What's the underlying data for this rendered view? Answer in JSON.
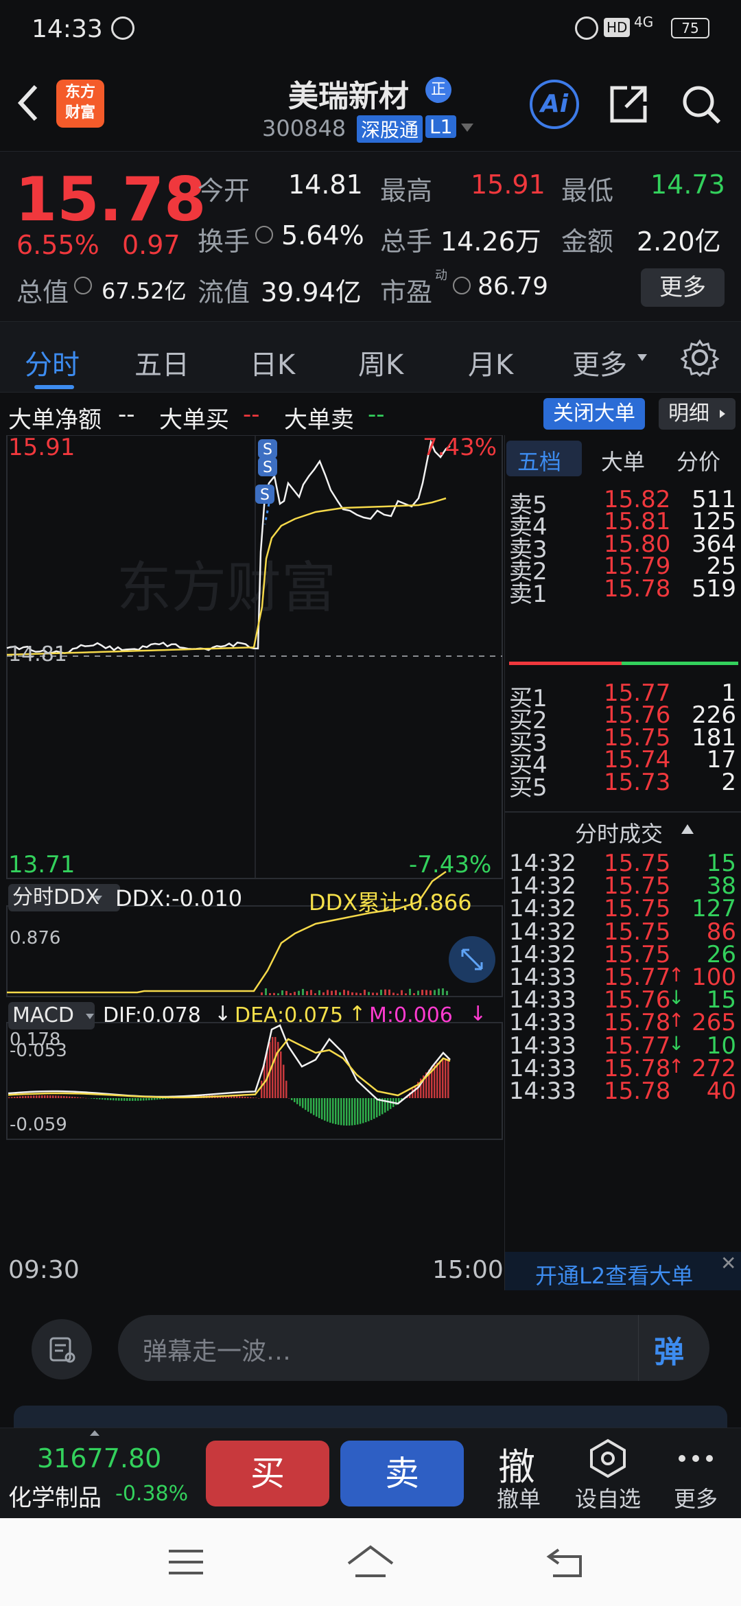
{
  "status_bar": {
    "time": "14:33",
    "battery": "75",
    "network": "4G"
  },
  "header": {
    "title": "美瑞新材",
    "badge": "正",
    "code": "300848",
    "market_tag": "深股通",
    "level_tag": "L1",
    "logo_line1": "东方",
    "logo_line2": "财富"
  },
  "quote": {
    "price": "15.78",
    "change_pct": "6.55%",
    "change_amt": "0.97",
    "open_label": "今开",
    "open": "14.81",
    "high_label": "最高",
    "high": "15.91",
    "low_label": "最低",
    "low": "14.73",
    "turnover_label": "换手",
    "turnover": "5.64%",
    "volume_label": "总手",
    "volume": "14.26万",
    "amount_label": "金额",
    "amount": "2.20亿",
    "mktcap_label": "总值",
    "mktcap": "67.52亿",
    "float_label": "流值",
    "float_cap": "39.94亿",
    "pe_label": "市盈",
    "pe_sup": "动",
    "pe": "86.79",
    "more_button": "更多"
  },
  "tabs": [
    "分时",
    "五日",
    "日K",
    "周K",
    "月K",
    "更多"
  ],
  "legend": {
    "net_label": "大单净额",
    "net_val": "--",
    "buy_label": "大单买",
    "buy_val": "--",
    "sell_label": "大单卖",
    "sell_val": "--",
    "close_big_button": "关闭大单",
    "detail_button": "明细"
  },
  "chart": {
    "top_price": "15.91",
    "top_pct": "7.43%",
    "mid_price": "14.81",
    "bottom_price": "13.71",
    "bottom_pct": "-7.43%",
    "watermark": "东方财富",
    "signal_marker": "S",
    "time_start": "09:30",
    "time_end": "15:00"
  },
  "ddx": {
    "selector": "分时DDX",
    "ddx_label": "DDX:-0.010",
    "cum_label": "DDX累计:0.866",
    "top": "0.876",
    "bottom": "-0.053"
  },
  "macd": {
    "selector": "MACD",
    "dif": "DIF:0.078",
    "dea": "DEA:0.075",
    "m": "M:0.006",
    "top": "0.178",
    "bottom": "-0.059"
  },
  "order_book": {
    "tabs": [
      "五档",
      "大单",
      "分价"
    ],
    "asks": [
      {
        "label": "卖5",
        "price": "15.82",
        "vol": "511"
      },
      {
        "label": "卖4",
        "price": "15.81",
        "vol": "125"
      },
      {
        "label": "卖3",
        "price": "15.80",
        "vol": "364"
      },
      {
        "label": "卖2",
        "price": "15.79",
        "vol": "25"
      },
      {
        "label": "卖1",
        "price": "15.78",
        "vol": "519"
      }
    ],
    "bids": [
      {
        "label": "买1",
        "price": "15.77",
        "vol": "1"
      },
      {
        "label": "买2",
        "price": "15.76",
        "vol": "226"
      },
      {
        "label": "买3",
        "price": "15.75",
        "vol": "181"
      },
      {
        "label": "买4",
        "price": "15.74",
        "vol": "17"
      },
      {
        "label": "买5",
        "price": "15.73",
        "vol": "2"
      }
    ],
    "trades_title": "分时成交",
    "trades": [
      {
        "time": "14:32",
        "price": "15.75",
        "arrow": "",
        "vol": "15",
        "dir": "sell"
      },
      {
        "time": "14:32",
        "price": "15.75",
        "arrow": "",
        "vol": "38",
        "dir": "sell"
      },
      {
        "time": "14:32",
        "price": "15.75",
        "arrow": "",
        "vol": "127",
        "dir": "sell"
      },
      {
        "time": "14:32",
        "price": "15.75",
        "arrow": "",
        "vol": "86",
        "dir": "buy"
      },
      {
        "time": "14:32",
        "price": "15.75",
        "arrow": "",
        "vol": "26",
        "dir": "sell"
      },
      {
        "time": "14:33",
        "price": "15.77",
        "arrow": "↑",
        "vol": "100",
        "dir": "buy"
      },
      {
        "time": "14:33",
        "price": "15.76",
        "arrow": "↓",
        "vol": "15",
        "dir": "sell"
      },
      {
        "time": "14:33",
        "price": "15.78",
        "arrow": "↑",
        "vol": "265",
        "dir": "buy"
      },
      {
        "time": "14:33",
        "price": "15.77",
        "arrow": "↓",
        "vol": "10",
        "dir": "sell"
      },
      {
        "time": "14:33",
        "price": "15.78",
        "arrow": "↑",
        "vol": "272",
        "dir": "buy"
      },
      {
        "time": "14:33",
        "price": "15.78",
        "arrow": "",
        "vol": "40",
        "dir": "buy"
      }
    ],
    "l2_promo": "开通L2查看大单"
  },
  "bullet": {
    "placeholder": "弹幕走一波…",
    "send_icon": "弹"
  },
  "bottom_bar": {
    "index_value": "31677.80",
    "index_name": "化学制品",
    "index_change": "-0.38%",
    "buy_button": "买",
    "sell_button": "卖",
    "cancel_icon": "撤",
    "cancel_label": "撤单",
    "fav_label": "设自选",
    "more_label": "更多"
  },
  "colors": {
    "up": "#f0383d",
    "down": "#33d15c",
    "accent": "#2f7bea",
    "bg": "#0e0f11"
  }
}
